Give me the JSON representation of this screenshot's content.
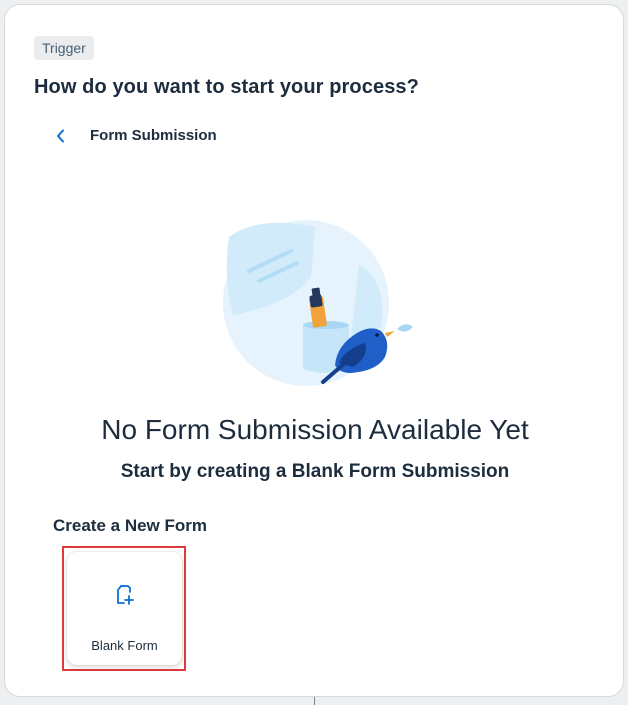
{
  "panel": {
    "badge": "Trigger",
    "heading": "How do you want to start your process?"
  },
  "subheader": {
    "back_icon": "chevron-left-icon",
    "title": "Form Submission"
  },
  "empty_state": {
    "illustration": "empty-form-bird-illustration",
    "title": "No Form Submission Available Yet",
    "subtitle": "Start by creating a Blank Form Submission"
  },
  "create_section": {
    "title": "Create a New Form",
    "tiles": [
      {
        "icon": "add-document-icon",
        "label": "Blank Form",
        "highlighted": true
      }
    ]
  },
  "colors": {
    "accent": "#0a6ed1",
    "highlight_border": "#e03b3b",
    "text": "#1d2d3e"
  }
}
